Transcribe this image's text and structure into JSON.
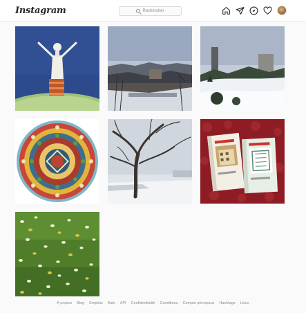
{
  "header": {
    "logo": "Instagram",
    "search_placeholder": "Rechercher",
    "nav_icons": [
      "home-icon",
      "direct-icon",
      "explore-icon",
      "activity-icon",
      "profile-avatar"
    ]
  },
  "posts": [
    {
      "subject": "painting-figure-on-tower"
    },
    {
      "subject": "city-winter-rooftops"
    },
    {
      "subject": "snowy-park-tower"
    },
    {
      "subject": "mandala-painting"
    },
    {
      "subject": "bare-tree-snow"
    },
    {
      "subject": "two-books-red-cloth"
    },
    {
      "subject": "leaves-on-grass"
    }
  ],
  "footer": {
    "links": [
      "À propos",
      "Blog",
      "Emplois",
      "Aide",
      "API",
      "Confidentialité",
      "Conditions",
      "Compte principaux",
      "Hashtags",
      "Lieux"
    ]
  },
  "colors": {
    "background": "#fafafa",
    "border": "#dbdbdb",
    "text": "#262626",
    "muted": "#8e8e8e"
  }
}
